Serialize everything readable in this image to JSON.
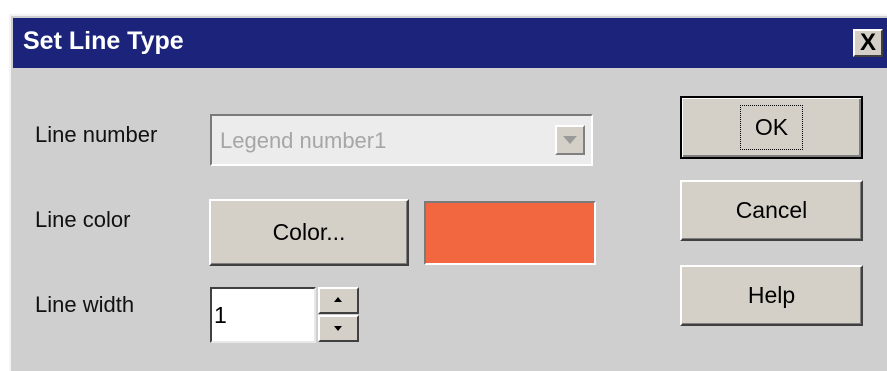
{
  "dialog": {
    "title": "Set Line Type",
    "close_label": "X"
  },
  "form": {
    "line_number_label": "Line number",
    "line_number_value": "Legend number1",
    "line_color_label": "Line color",
    "color_button_label": "Color...",
    "color_value": "#f2673f",
    "line_width_label": "Line width",
    "line_width_value": "1"
  },
  "buttons": {
    "ok": "OK",
    "cancel": "Cancel",
    "help": "Help"
  },
  "colors": {
    "titlebar": "#1b237b",
    "dialog_bg": "#cfcfcf",
    "swatch": "#f2673f"
  }
}
